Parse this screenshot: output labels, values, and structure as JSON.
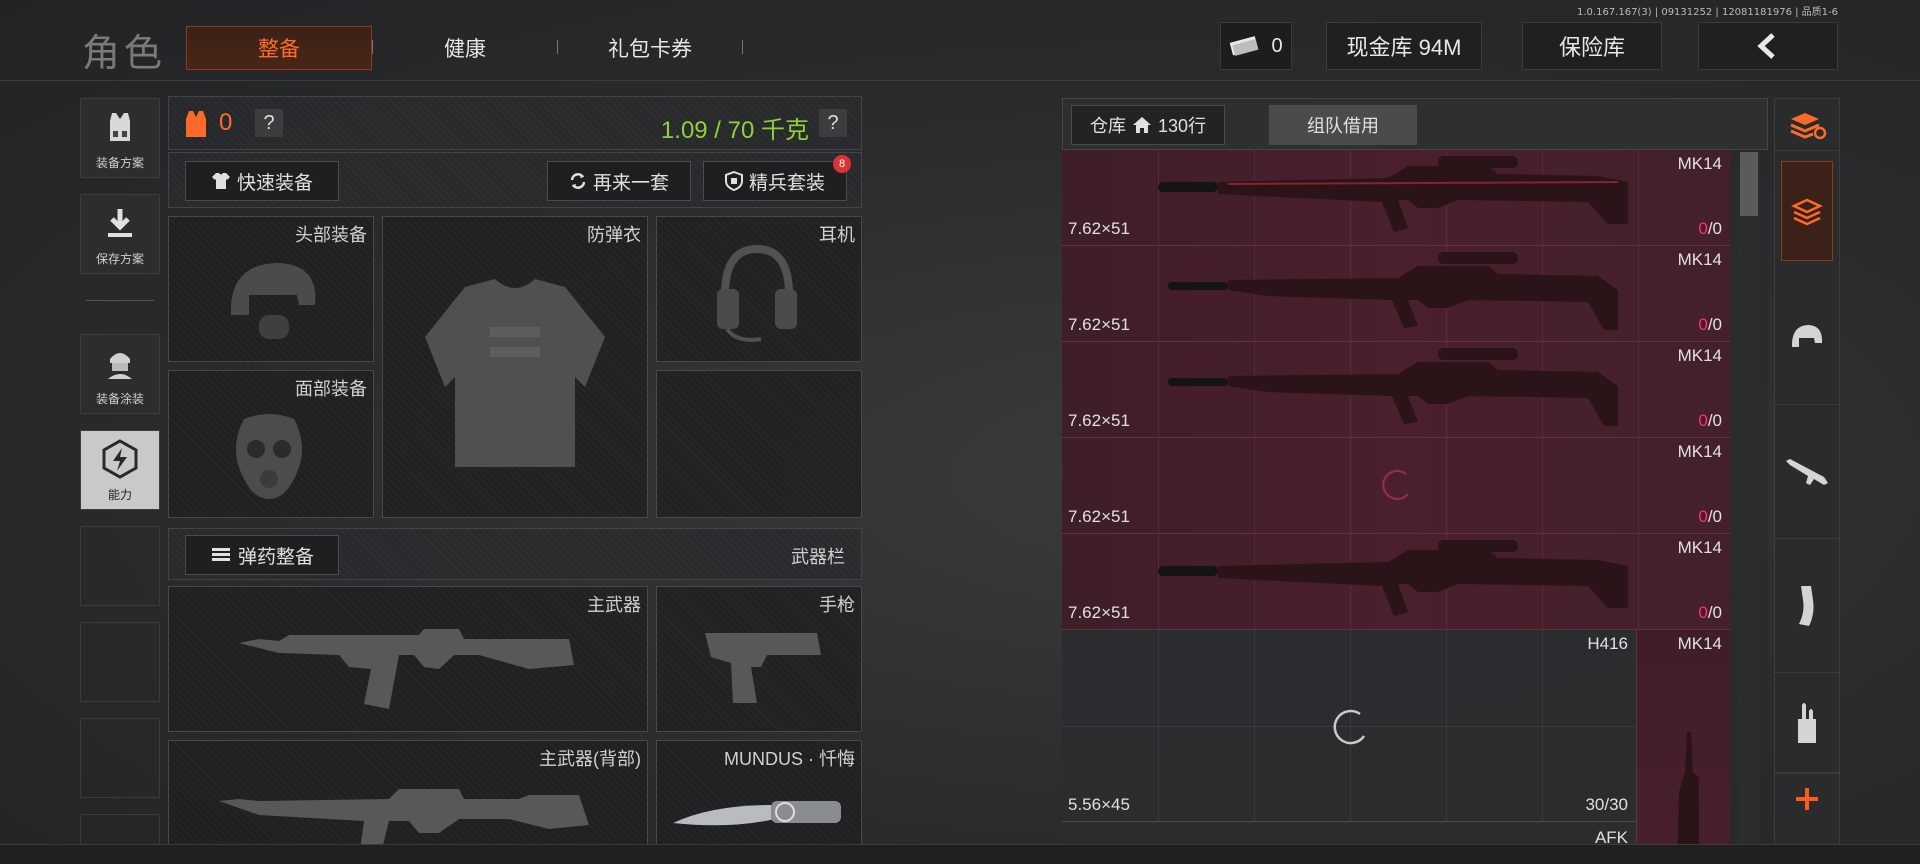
{
  "version": "1.0.167.167(3) | 09131252 | 12081181976 | 品质1-6",
  "header": {
    "title": "角色",
    "tabs": [
      "整备",
      "健康",
      "礼包卡券"
    ],
    "currency_value": "0",
    "cash_label": "现金库 94M",
    "safe_label": "保险库"
  },
  "sidebar": {
    "items": [
      {
        "label": "装备方案",
        "icon": "vest-icon"
      },
      {
        "label": "保存方案",
        "icon": "download-icon"
      },
      {
        "label": "装备涂装",
        "icon": "soldier-icon"
      },
      {
        "label": "能力",
        "icon": "lightning-hex-icon"
      }
    ]
  },
  "equipment": {
    "armor_count": "0",
    "weight": "1.09 / 70 千克",
    "quick_equip": "快速装备",
    "again": "再来一套",
    "elite": "精兵套装",
    "elite_badge": "8",
    "slots": {
      "head": "头部装备",
      "vest": "防弹衣",
      "earphone": "耳机",
      "face": "面部装备"
    },
    "ammo_btn": "弹药整备",
    "weapon_bar": "武器栏",
    "weapons": {
      "primary": "主武器",
      "pistol": "手枪",
      "primary_back": "主武器(背部)",
      "melee": "MUNDUS · 忏悔"
    }
  },
  "warehouse": {
    "tab_label": "仓库",
    "rows": "130行",
    "team_tab": "组队借用",
    "items": [
      {
        "name": "MK14",
        "caliber": "7.62×51",
        "count_red": "0",
        "count_total": "/0"
      },
      {
        "name": "MK14",
        "caliber": "7.62×51",
        "count_red": "0",
        "count_total": "/0"
      },
      {
        "name": "MK14",
        "caliber": "7.62×51",
        "count_red": "0",
        "count_total": "/0"
      },
      {
        "name": "MK14",
        "caliber": "7.62×51",
        "count_red": "0",
        "count_total": "/0"
      },
      {
        "name": "MK14",
        "caliber": "7.62×51",
        "count_red": "0",
        "count_total": "/0"
      }
    ],
    "h416": {
      "name": "H416",
      "caliber": "5.56×45",
      "count": "30/30"
    },
    "side_mk14": "MK14",
    "afk": "AFK"
  },
  "colors": {
    "accent": "#ff6a2a",
    "weight_green": "#8fd13a",
    "count_red": "#ff2e7a"
  }
}
